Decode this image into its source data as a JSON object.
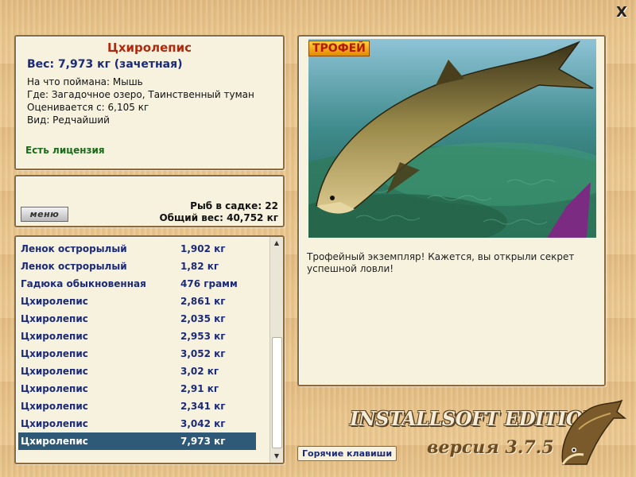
{
  "window": {
    "close_label": "X"
  },
  "info": {
    "name": "Цхиролепис",
    "weight": "Вес: 7,973 кг (зачетная)",
    "details": [
      "На что поймана: Мышь",
      "Где: Загадочное озеро, Таинственный туман",
      "Оценивается с: 6,105 кг",
      "Вид: Редчайший"
    ],
    "license": "Есть лицензия"
  },
  "cage": {
    "menu_label": "меню",
    "fish_count": "Рыб в садке: 22",
    "total_weight": "Общий вес: 40,752 кг"
  },
  "catch_list": [
    {
      "name": "Ленок острорылый",
      "weight": "1,902 кг"
    },
    {
      "name": "Ленок острорылый",
      "weight": "1,82 кг"
    },
    {
      "name": "Гадюка обыкновенная",
      "weight": "476 грамм"
    },
    {
      "name": "Цхиролепис",
      "weight": "2,861 кг"
    },
    {
      "name": "Цхиролепис",
      "weight": "2,035 кг"
    },
    {
      "name": "Цхиролепис",
      "weight": "2,953 кг"
    },
    {
      "name": "Цхиролепис",
      "weight": "3,052 кг"
    },
    {
      "name": "Цхиролепис",
      "weight": "3,02 кг"
    },
    {
      "name": "Цхиролепис",
      "weight": "2,91 кг"
    },
    {
      "name": "Цхиролепис",
      "weight": "2,341 кг"
    },
    {
      "name": "Цхиролепис",
      "weight": "3,042 кг"
    },
    {
      "name": "Цхиролепис",
      "weight": "7,973 кг"
    }
  ],
  "selected_index": 11,
  "trophy": {
    "badge": "ТРОФЕЙ",
    "caption": "Трофейный экземпляр! Кажется, вы открыли секрет успешной ловли!"
  },
  "hotkeys_label": "Горячие клавиши",
  "branding": {
    "edition": "INSTALLSOFT EDITION",
    "version": "версия 3.7.5"
  },
  "colors": {
    "accent_name": "#b0290d",
    "list_text": "#1c2a7a",
    "selection": "#2f5a77",
    "license": "#1a6b1a"
  }
}
